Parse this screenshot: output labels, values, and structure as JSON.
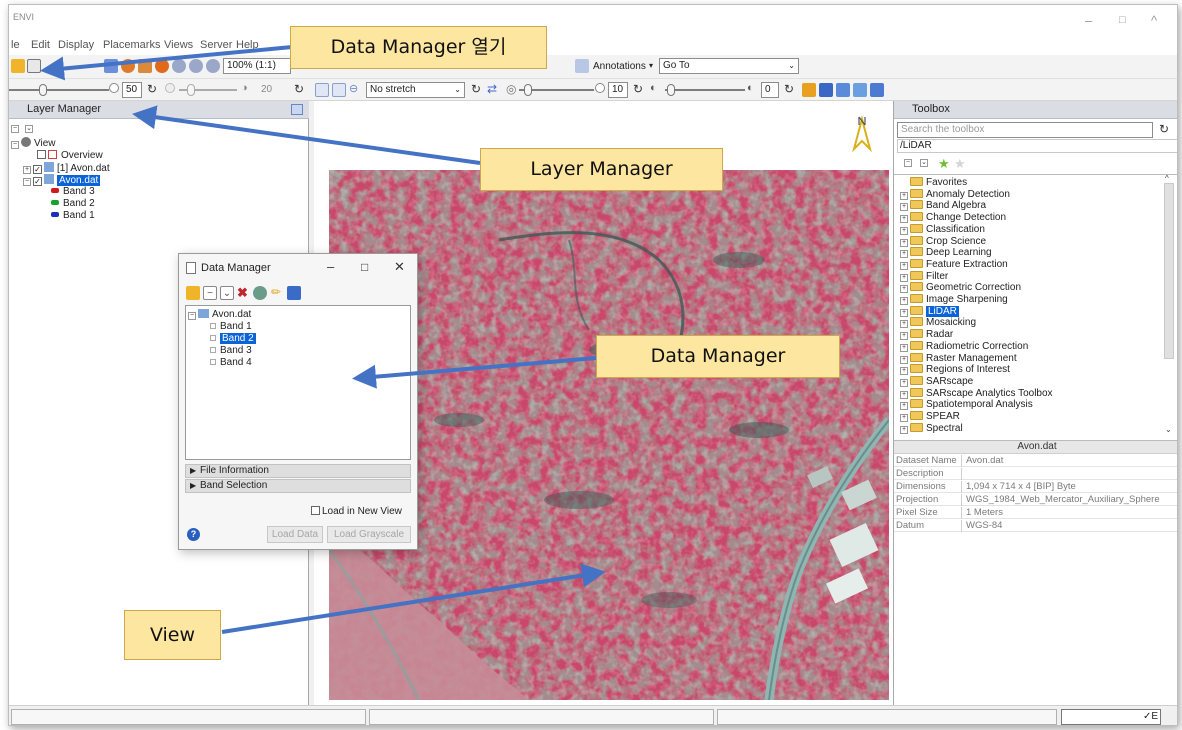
{
  "window": {
    "title": "ENVI",
    "controls": {
      "minimize": "–",
      "maximize": "□",
      "close": "^"
    }
  },
  "menu": [
    "le",
    "Edit",
    "Display",
    "Placemarks",
    "Views",
    "Server",
    "Help"
  ],
  "toolbar": {
    "zoom_value": "100% (1:1)",
    "annotations_label": "Annotations",
    "goto_label": "Go To",
    "stretch_value": "No stretch",
    "brightness_value": "50",
    "contrast_value": "20",
    "sharpen_value": "10",
    "transparency_value": "0"
  },
  "layer_manager": {
    "title": "Layer Manager",
    "root": "View",
    "overview": "Overview",
    "layer_1": "[1] Avon.dat",
    "layer_2": "Avon.dat",
    "bands": [
      {
        "label": "Band 3",
        "color": "#d11b1b"
      },
      {
        "label": "Band 2",
        "color": "#17a32a"
      },
      {
        "label": "Band 1",
        "color": "#1c2fb8"
      }
    ]
  },
  "toolbox": {
    "title": "Toolbox",
    "search_placeholder": "Search the toolbox",
    "search_path": "/LiDAR",
    "items": [
      "Favorites",
      "Anomaly Detection",
      "Band Algebra",
      "Change Detection",
      "Classification",
      "Crop Science",
      "Deep Learning",
      "Feature Extraction",
      "Filter",
      "Geometric Correction",
      "Image Sharpening",
      "LiDAR",
      "Mosaicking",
      "Radar",
      "Radiometric Correction",
      "Raster Management",
      "Regions of Interest",
      "SARscape",
      "SARscape Analytics Toolbox",
      "Spatiotemporal Analysis",
      "SPEAR",
      "Spectral"
    ],
    "selected_item": "LiDAR"
  },
  "properties": {
    "title": "Avon.dat",
    "rows": [
      {
        "key": "Dataset Name",
        "value": "Avon.dat"
      },
      {
        "key": "Description",
        "value": ""
      },
      {
        "key": "Dimensions",
        "value": "1,094 x 714 x 4 [BIP] Byte"
      },
      {
        "key": "Projection",
        "value": "WGS_1984_Web_Mercator_Auxiliary_Sphere"
      },
      {
        "key": "Pixel Size",
        "value": "1 Meters"
      },
      {
        "key": "Datum",
        "value": "WGS-84"
      }
    ]
  },
  "data_manager": {
    "title": "Data Manager",
    "file": "Avon.dat",
    "bands": [
      "Band 1",
      "Band 2",
      "Band 3",
      "Band 4"
    ],
    "selected_band": "Band 2",
    "sections": [
      "File Information",
      "Band Selection"
    ],
    "load_new_view": "Load in New View",
    "load_data": "Load Data",
    "load_grayscale": "Load Grayscale",
    "help": "?"
  },
  "callouts": {
    "open_dm": "Data Manager 열기",
    "layer_manager": "Layer Manager",
    "data_manager": "Data Manager",
    "view": "View"
  },
  "statusbar": {
    "right_text": "✓E"
  },
  "colors": {
    "callout_fill": "#fde6a0",
    "arrow": "#4472c4",
    "vegetation": "#c8476a",
    "selection": "#0a64d8"
  }
}
